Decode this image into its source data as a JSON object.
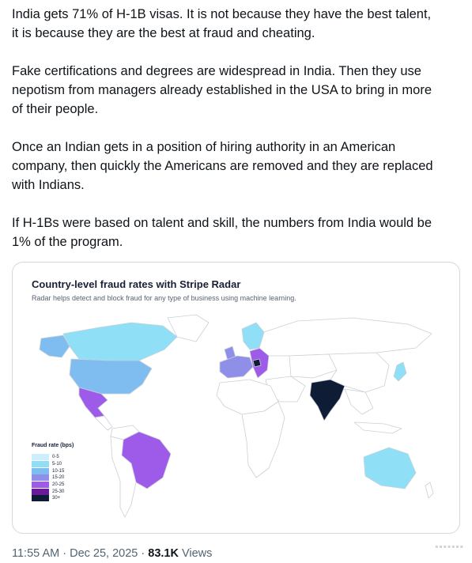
{
  "tweet": {
    "paragraphs": [
      "India gets 71% of H-1B visas. It is not because they have the best talent,\nit is because they are the best at fraud and cheating.",
      "Fake certifications and degrees are widespread in India. Then they use\nnepotism from managers already established in the USA to bring in more\nof their people.",
      "Once an Indian gets in a position of hiring authority in an American\ncompany, then quickly the Americans are removed and they are replaced\nwith Indians.",
      "If H-1Bs were based on talent and skill, the numbers from India would be\n1% of the program."
    ]
  },
  "media": {
    "title": "Country-level fraud rates with Stripe Radar",
    "subtitle": "Radar helps detect and block fraud for any type of business using machine learning.",
    "legend": {
      "title": "Fraud rate (bps)",
      "items": [
        {
          "label": "0-5",
          "color": "#cdeffb"
        },
        {
          "label": "5-10",
          "color": "#8fe0f7"
        },
        {
          "label": "10-15",
          "color": "#7fbdf0"
        },
        {
          "label": "15-20",
          "color": "#8f8fe9"
        },
        {
          "label": "20-25",
          "color": "#9e5bea"
        },
        {
          "label": "25-30",
          "color": "#6a1b9a"
        },
        {
          "label": "30+",
          "color": "#0f1c35"
        }
      ]
    },
    "regions": {
      "default_fill": "#ffffff",
      "outline": "#c9d0d8",
      "canada": "#8fe0f7",
      "usa": "#7fbdf0",
      "alaska": "#7fbdf0",
      "greenland": "#ffffff",
      "mexico": "#9e5bea",
      "brazil": "#9e5bea",
      "india": "#0f1c35",
      "australia": "#8fe0f7",
      "japan": "#8fe0f7",
      "europe_west": "#8f8fe9",
      "europe_east": "#9e5bea",
      "scandinavia": "#8fe0f7"
    }
  },
  "meta": {
    "time": "11:55 AM",
    "date": "Dec 25, 2025",
    "views_count": "83.1K",
    "views_label": "Views"
  },
  "icons": {
    "watermark": "watermark-icon"
  }
}
